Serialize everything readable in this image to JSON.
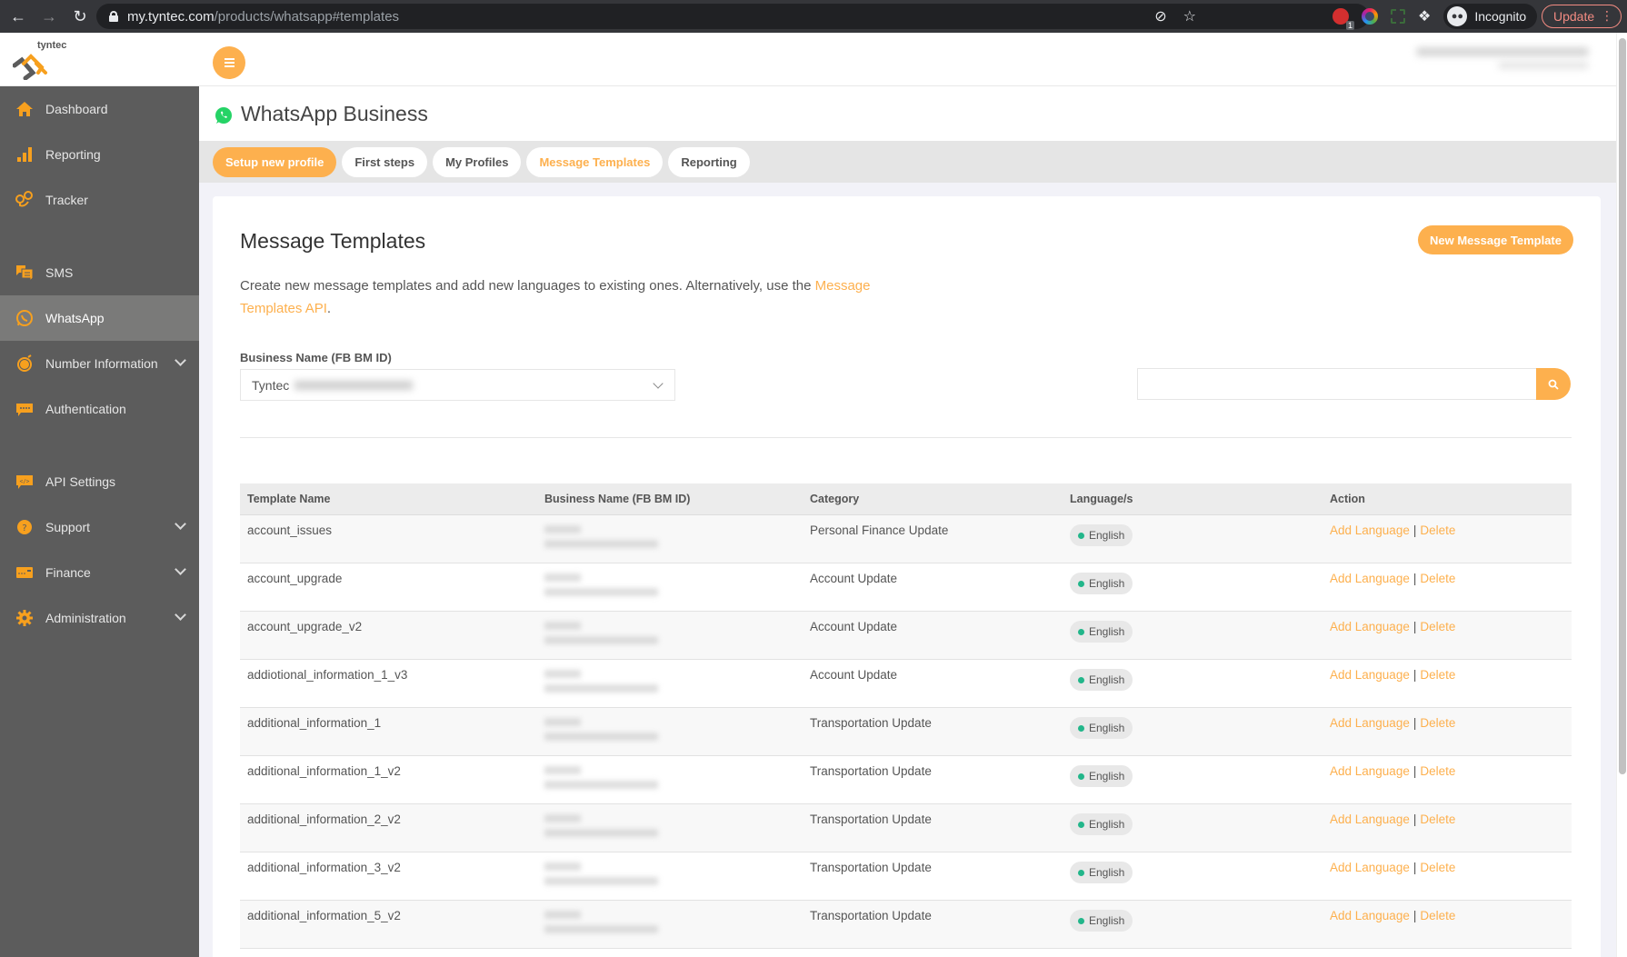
{
  "browser": {
    "url_host": "my.tyntec.com",
    "url_path": "/products/whatsapp#templates",
    "incognito_label": "Incognito",
    "update_label": "Update",
    "extension_badge": "1"
  },
  "header": {
    "logo_text": "tyntec"
  },
  "sidebar": {
    "items": [
      {
        "label": "Dashboard",
        "icon": "home-icon"
      },
      {
        "label": "Reporting",
        "icon": "bar-chart-icon"
      },
      {
        "label": "Tracker",
        "icon": "location-pins-icon"
      },
      {
        "label": "SMS",
        "icon": "chat-bubbles-icon"
      },
      {
        "label": "WhatsApp",
        "icon": "whatsapp-icon",
        "active": true
      },
      {
        "label": "Number Information",
        "icon": "number-info-icon",
        "expandable": true
      },
      {
        "label": "Authentication",
        "icon": "password-bubble-icon"
      },
      {
        "label": "API Settings",
        "icon": "code-bubble-icon"
      },
      {
        "label": "Support",
        "icon": "question-icon",
        "expandable": true
      },
      {
        "label": "Finance",
        "icon": "credit-card-icon",
        "expandable": true
      },
      {
        "label": "Administration",
        "icon": "gear-icon",
        "expandable": true
      }
    ]
  },
  "page": {
    "title": "WhatsApp Business",
    "tabs": [
      {
        "label": "Setup new profile",
        "style": "primary"
      },
      {
        "label": "First steps"
      },
      {
        "label": "My Profiles"
      },
      {
        "label": "Message Templates",
        "active": true
      },
      {
        "label": "Reporting"
      }
    ]
  },
  "templates": {
    "title": "Message Templates",
    "new_button": "New Message Template",
    "description": "Create new message templates and add new languages to existing ones. Alternatively, use the ",
    "description_link": "Message Templates API",
    "description_end": ".",
    "business_label": "Business Name (FB BM ID)",
    "business_value": "Tyntec",
    "search_placeholder": "",
    "columns": [
      "Template Name",
      "Business Name (FB BM ID)",
      "Category",
      "Language/s",
      "Action"
    ],
    "rows": [
      {
        "name": "account_issues",
        "category": "Personal Finance Update",
        "language": "English"
      },
      {
        "name": "account_upgrade",
        "category": "Account Update",
        "language": "English"
      },
      {
        "name": "account_upgrade_v2",
        "category": "Account Update",
        "language": "English"
      },
      {
        "name": "addiotional_information_1_v3",
        "category": "Account Update",
        "language": "English"
      },
      {
        "name": "additional_information_1",
        "category": "Transportation Update",
        "language": "English"
      },
      {
        "name": "additional_information_1_v2",
        "category": "Transportation Update",
        "language": "English"
      },
      {
        "name": "additional_information_2_v2",
        "category": "Transportation Update",
        "language": "English"
      },
      {
        "name": "additional_information_3_v2",
        "category": "Transportation Update",
        "language": "English"
      },
      {
        "name": "additional_information_5_v2",
        "category": "Transportation Update",
        "language": "English"
      }
    ],
    "action_add": "Add Language",
    "action_sep": "|",
    "action_delete": "Delete"
  },
  "colors": {
    "accent": "#fdb04e",
    "sidebar_bg": "#5c5c5c",
    "sidebar_active": "#7a7a79",
    "language_dot": "#22b68a",
    "whatsapp_green": "#25d366"
  }
}
